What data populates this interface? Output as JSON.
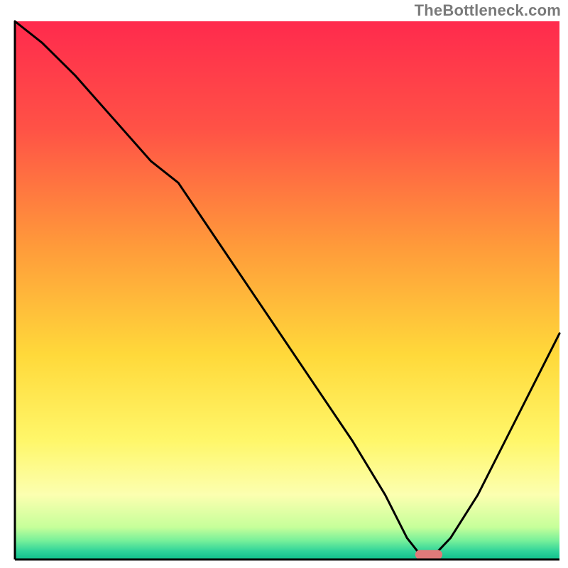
{
  "watermark": "TheBottleneck.com",
  "chart_data": {
    "type": "line",
    "title": "",
    "xlabel": "",
    "ylabel": "",
    "xlim": [
      0,
      100
    ],
    "ylim": [
      0,
      100
    ],
    "background_gradient_stops": [
      {
        "offset": 0.0,
        "color": "#ff2a4d"
      },
      {
        "offset": 0.2,
        "color": "#ff5246"
      },
      {
        "offset": 0.42,
        "color": "#ff9b3a"
      },
      {
        "offset": 0.62,
        "color": "#ffd93a"
      },
      {
        "offset": 0.78,
        "color": "#fff76a"
      },
      {
        "offset": 0.88,
        "color": "#fcffb0"
      },
      {
        "offset": 0.94,
        "color": "#c6ff9a"
      },
      {
        "offset": 0.965,
        "color": "#77f09a"
      },
      {
        "offset": 0.985,
        "color": "#2ed39a"
      },
      {
        "offset": 1.0,
        "color": "#0fbf8c"
      }
    ],
    "series": [
      {
        "name": "bottleneck-curve",
        "color": "#000000",
        "x": [
          0,
          5,
          11,
          18,
          25,
          30,
          38,
          46,
          54,
          62,
          68,
          72,
          74.5,
          77,
          80,
          85,
          90,
          95,
          100
        ],
        "values": [
          100,
          96,
          90,
          82,
          74,
          70,
          58,
          46,
          34,
          22,
          12,
          4,
          0.8,
          0.8,
          4,
          12,
          22,
          32,
          42
        ]
      }
    ],
    "marker": {
      "name": "optimal-range",
      "color": "#e07a7a",
      "x_start": 73.5,
      "x_end": 78.5,
      "y": 0.9,
      "thickness": 1.7
    },
    "axes": {
      "show_ticks": false,
      "frame_color": "#000000",
      "frame_width": 3
    }
  }
}
